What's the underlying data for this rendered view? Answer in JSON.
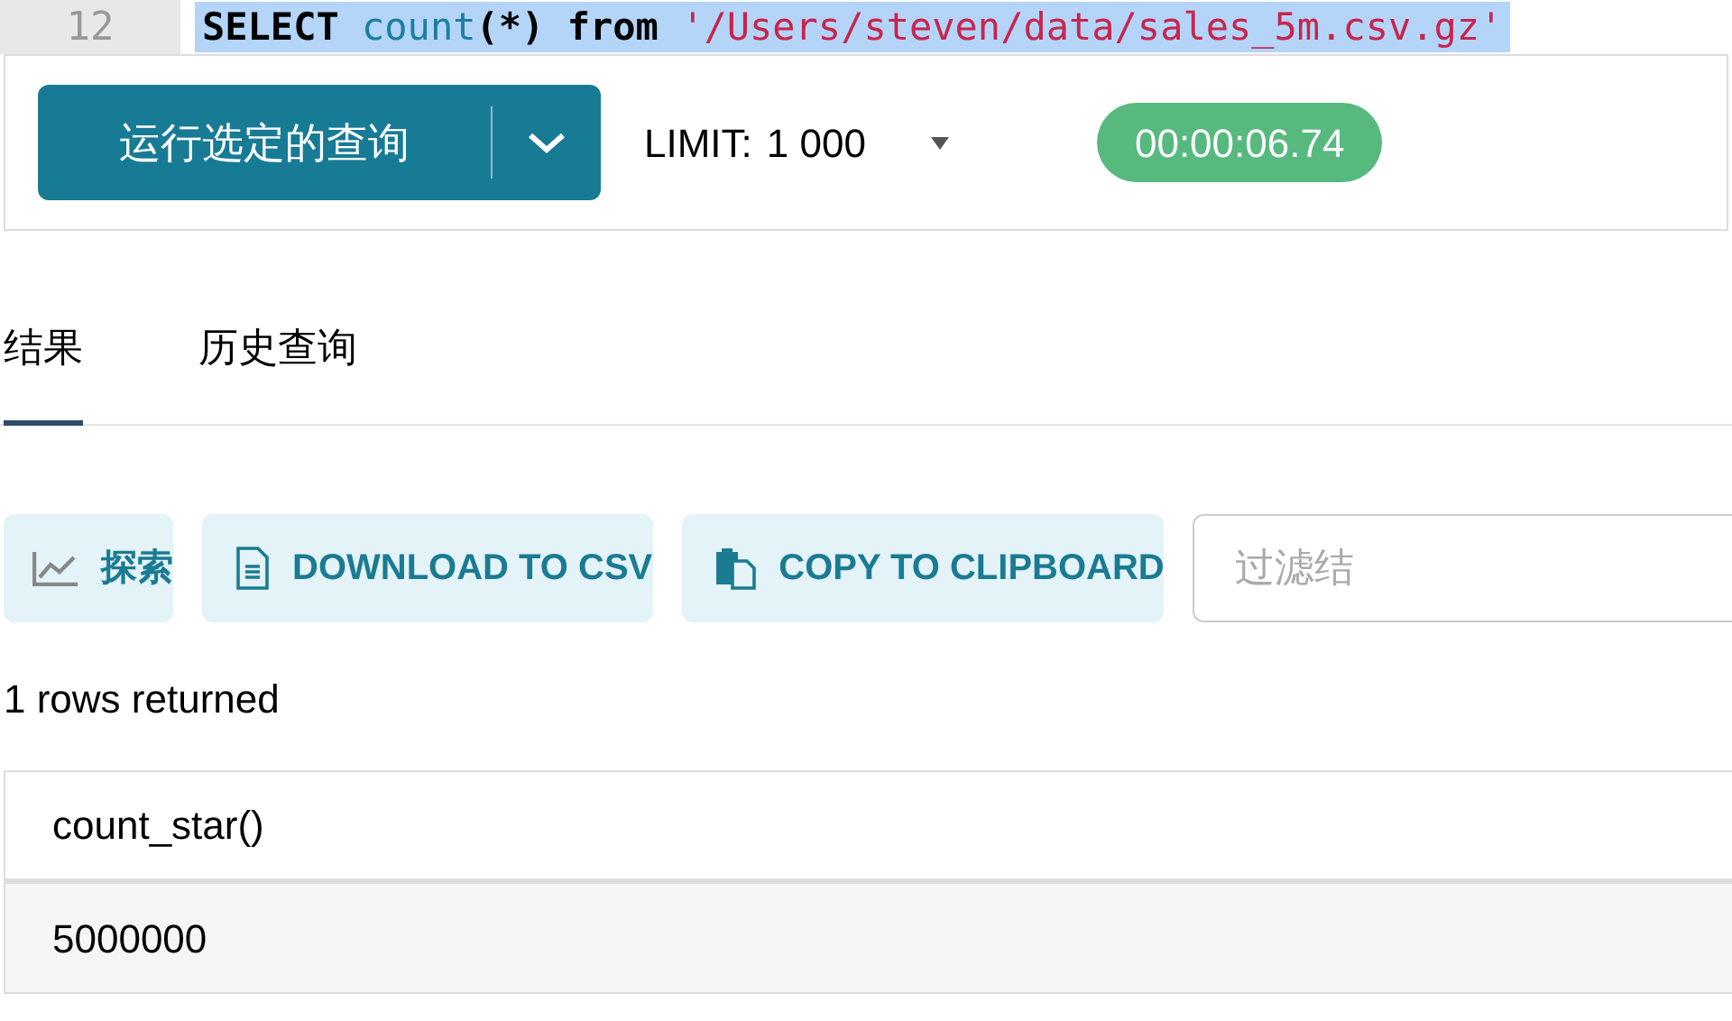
{
  "editor": {
    "line_number": "12",
    "selected": true,
    "tokens": [
      {
        "kind": "keyword",
        "text": "SELECT"
      },
      {
        "kind": "function",
        "text": "count"
      },
      {
        "kind": "punct",
        "text": "(*)"
      },
      {
        "kind": "keyword",
        "text": "from"
      },
      {
        "kind": "string",
        "text": "'/Users/steven/data/sales_5m.csv.gz'"
      }
    ]
  },
  "toolbar": {
    "run_button": "运行选定的查询",
    "limit_label": "LIMIT:",
    "limit_value": "1 000",
    "timer": "00:00:06.74"
  },
  "tabs": [
    {
      "label": "结果",
      "selected": true
    },
    {
      "label": "历史查询",
      "selected": false
    }
  ],
  "actions": [
    {
      "kind": "chart",
      "label": "探索"
    },
    {
      "kind": "file",
      "label": "DOWNLOAD TO CSV"
    },
    {
      "kind": "copy",
      "label": "COPY TO CLIPBOARD"
    }
  ],
  "filter": {
    "placeholder": "过滤结"
  },
  "status": "1 rows returned",
  "table": {
    "columns": [
      "count_star()"
    ],
    "rows": [
      [
        "5000000"
      ]
    ]
  }
}
